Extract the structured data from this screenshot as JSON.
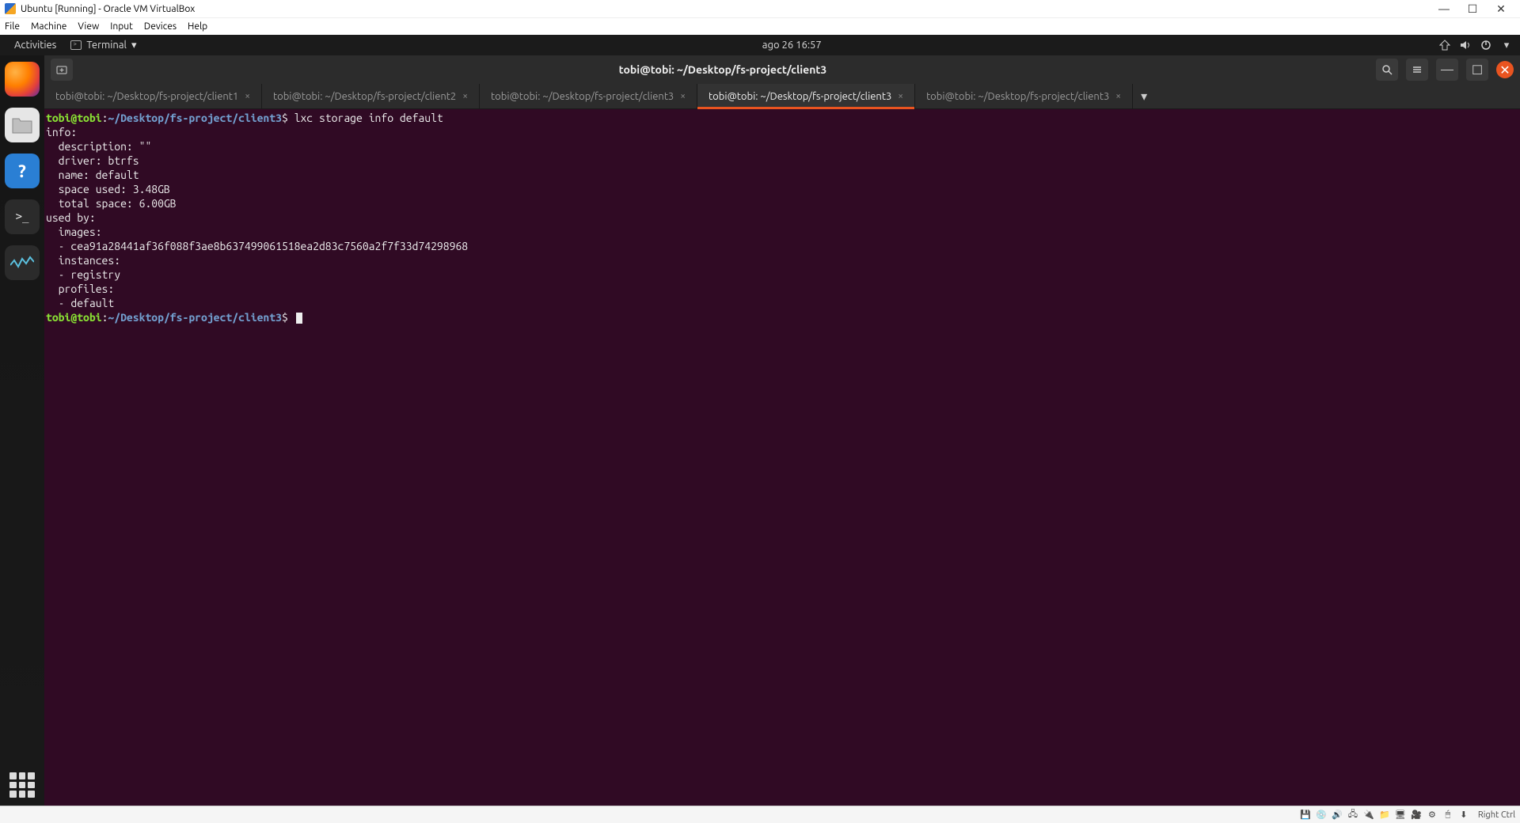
{
  "vbox": {
    "title": "Ubuntu [Running] - Oracle VM VirtualBox",
    "menus": [
      "File",
      "Machine",
      "View",
      "Input",
      "Devices",
      "Help"
    ],
    "hostkey": "Right Ctrl"
  },
  "ubuntu": {
    "activities": "Activities",
    "app_menu": "Terminal",
    "clock": "ago 26  16:57"
  },
  "terminal": {
    "window_title": "tobi@tobi: ~/Desktop/fs-project/client3",
    "tabs": [
      {
        "label": "tobi@tobi: ~/Desktop/fs-project/client1",
        "active": false
      },
      {
        "label": "tobi@tobi: ~/Desktop/fs-project/client2",
        "active": false
      },
      {
        "label": "tobi@tobi: ~/Desktop/fs-project/client3",
        "active": false
      },
      {
        "label": "tobi@tobi: ~/Desktop/fs-project/client3",
        "active": true
      },
      {
        "label": "tobi@tobi: ~/Desktop/fs-project/client3",
        "active": false
      }
    ],
    "prompt": {
      "userhost": "tobi@tobi",
      "colon": ":",
      "path": "~/Desktop/fs-project/client3",
      "symbol": "$"
    },
    "command": "lxc storage info default",
    "output_lines": [
      "info:",
      "  description: \"\"",
      "  driver: btrfs",
      "  name: default",
      "  space used: 3.48GB",
      "  total space: 6.00GB",
      "used by:",
      "  images:",
      "  - cea91a28441af36f088f3ae8b637499061518ea2d83c7560a2f7f33d74298968",
      "  instances:",
      "  - registry",
      "  profiles:",
      "  - default"
    ]
  }
}
